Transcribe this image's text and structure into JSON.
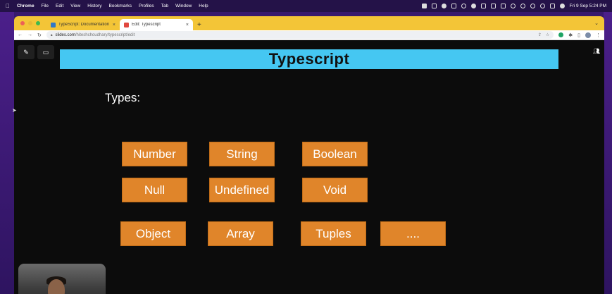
{
  "menubar": {
    "app": "Chrome",
    "items": [
      "File",
      "Edit",
      "View",
      "History",
      "Bookmarks",
      "Profiles",
      "Tab",
      "Window",
      "Help"
    ],
    "clock": "Fri 9 Sep  5:24 PM"
  },
  "browser": {
    "tabs": [
      {
        "label": "TypeScript: Documentation - T",
        "active": false,
        "icon": "typescript-favicon"
      },
      {
        "label": "Edit: Typescript",
        "active": true,
        "icon": "slides-favicon"
      }
    ],
    "url": {
      "host": "slides.com",
      "path": "/hiteshchoudhary/typescript/edit"
    }
  },
  "slide": {
    "title": "Typescript",
    "subtitle": "Types:",
    "types": [
      "Number",
      "String",
      "Boolean",
      "Null",
      "Undefined",
      "Void",
      "Object",
      "Array",
      "Tuples",
      "...."
    ]
  },
  "colors": {
    "title_bar": "#45c7f2",
    "type_box": "#e0852a",
    "tabbar": "#f3c537"
  }
}
